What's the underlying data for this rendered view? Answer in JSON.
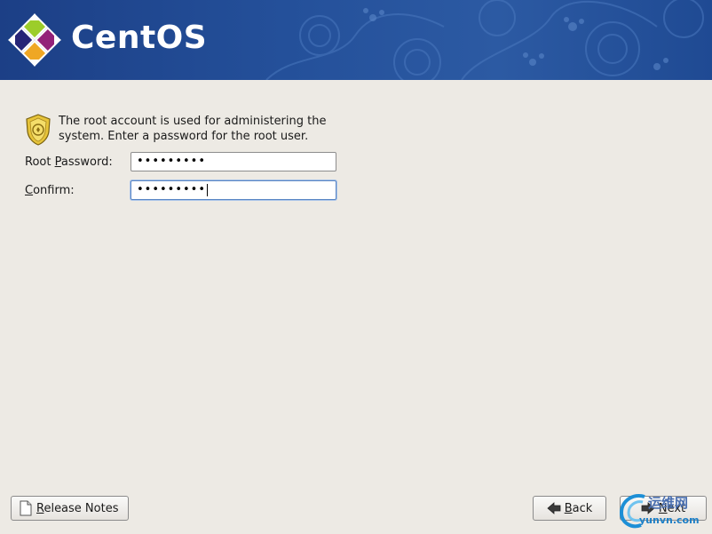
{
  "header": {
    "logo_text": "CentOS",
    "logo_icon": "centos-logo-icon"
  },
  "intro": {
    "icon": "security-badge-icon",
    "text": "The root account is used for administering the system.  Enter a password for the root user."
  },
  "form": {
    "root_password": {
      "label_before": "Root ",
      "label_mnemonic": "P",
      "label_after": "assword:",
      "value": "•••••••••"
    },
    "confirm": {
      "label_before": "",
      "label_mnemonic": "C",
      "label_after": "onfirm:",
      "value": "•••••••••"
    }
  },
  "buttons": {
    "release_notes": {
      "mnemonic": "R",
      "rest": "elease Notes",
      "icon": "document-icon"
    },
    "back": {
      "mnemonic": "B",
      "rest": "ack",
      "icon": "arrow-left-icon"
    },
    "next": {
      "mnemonic": "N",
      "rest": "ext",
      "icon": "arrow-right-icon"
    }
  },
  "watermark": {
    "cn": "运维网",
    "en": "yunvn.com"
  },
  "colors": {
    "banner": "#24509a",
    "background": "#edeae4",
    "focus": "#5a86c4"
  }
}
